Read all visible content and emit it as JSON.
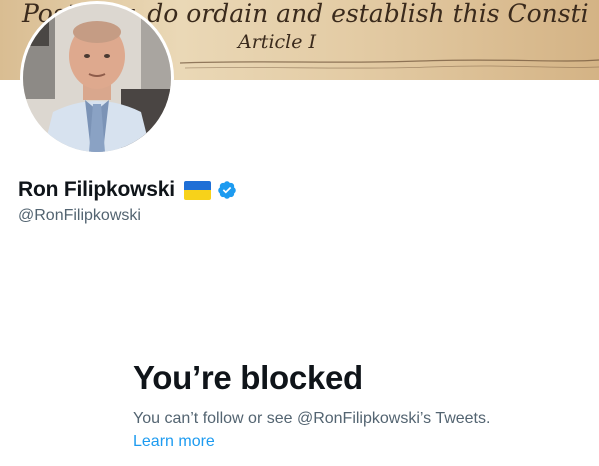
{
  "banner": {
    "script_line": "Posterity, do ordain and establish this Consti",
    "article_heading": "Article I"
  },
  "profile": {
    "display_name": "Ron Filipkowski",
    "handle": "@RonFilipkowski",
    "flag_icon": "ukraine-flag-icon",
    "verified_icon": "verified-badge-icon"
  },
  "blocked": {
    "title": "You’re blocked",
    "description": "You can’t follow or see @RonFilipkowski’s Tweets.",
    "learn_more": "Learn more"
  },
  "colors": {
    "text_primary": "#0f1419",
    "text_secondary": "#536471",
    "link": "#1d9bf0",
    "verified": "#1d9bf0",
    "flag_blue": "#1f6fd6",
    "flag_yellow": "#f7d21a"
  }
}
